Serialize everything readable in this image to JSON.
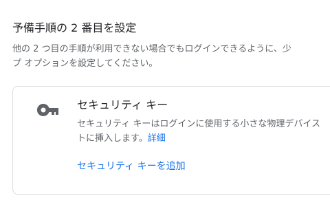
{
  "section": {
    "heading": "予備手順の 2 番目を設定",
    "description_line1": "他の 2 つ目の手順が利用できない場合でもログインできるように、少",
    "description_line2": "プ オプションを設定してください。"
  },
  "security_key_card": {
    "icon": "key-icon",
    "title": "セキュリティ キー",
    "description_line1": "セキュリティ キーはログインに使用する小さな物理デバイス",
    "description_line2": "トに挿入します。",
    "details_link": "詳細",
    "add_link": "セキュリティ キーを追加"
  },
  "colors": {
    "link": "#1a73e8",
    "text_primary": "#202124",
    "text_secondary": "#5f6368",
    "border": "#dadce0"
  }
}
